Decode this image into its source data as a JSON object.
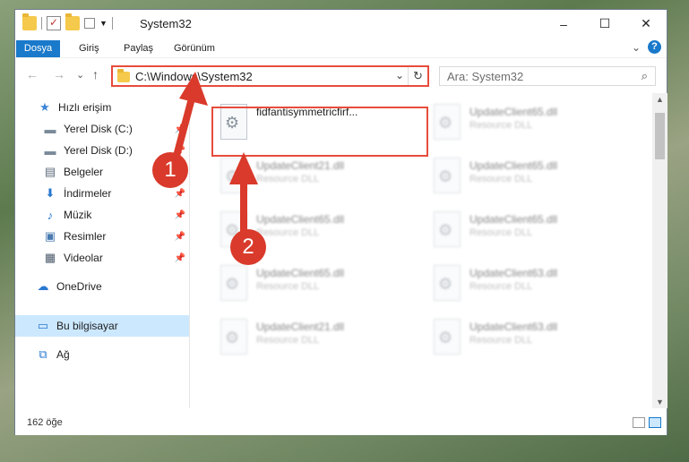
{
  "window": {
    "title": "System32",
    "controls": [
      "–",
      "☐",
      "✕"
    ]
  },
  "ribbon": {
    "tabs": [
      "Dosya",
      "Giriş",
      "Paylaş",
      "Görünüm"
    ],
    "chevron": "⌄",
    "help": "?"
  },
  "navbar": {
    "back": "←",
    "forward": "→",
    "recent": "⌄",
    "up": "↑",
    "address": "C:\\Windows\\System32",
    "address_dropdown": "⌄",
    "refresh": "↻",
    "search_placeholder": "Ara: System32",
    "search_icon": "⌕"
  },
  "sidebar": {
    "items": [
      {
        "label": "Hızlı erişim",
        "icon": "star-icon",
        "glyph": "★",
        "color": "#3b84d6",
        "pinned": false
      },
      {
        "label": "Yerel Disk (C:)",
        "icon": "drive-icon",
        "glyph": "▬",
        "color": "#7a8a99",
        "pinned": true
      },
      {
        "label": "Yerel Disk (D:)",
        "icon": "drive-icon",
        "glyph": "▬",
        "color": "#7a8a99",
        "pinned": true
      },
      {
        "label": "Belgeler",
        "icon": "documents-icon",
        "glyph": "▤",
        "color": "#5b6b7a",
        "pinned": true
      },
      {
        "label": "İndirmeler",
        "icon": "download-icon",
        "glyph": "⬇",
        "color": "#2a78d0",
        "pinned": true
      },
      {
        "label": "Müzik",
        "icon": "music-icon",
        "glyph": "♪",
        "color": "#2a78d0",
        "pinned": true
      },
      {
        "label": "Resimler",
        "icon": "pictures-icon",
        "glyph": "▣",
        "color": "#4a7ab0",
        "pinned": true
      },
      {
        "label": "Videolar",
        "icon": "videos-icon",
        "glyph": "▦",
        "color": "#4a5a6a",
        "pinned": true
      },
      {
        "label": "OneDrive",
        "icon": "onedrive-icon",
        "glyph": "☁",
        "color": "#2a78d0",
        "pinned": false
      },
      {
        "label": "Bu bilgisayar",
        "icon": "computer-icon",
        "glyph": "▭",
        "color": "#2a78d0",
        "pinned": false
      },
      {
        "label": "Ağ",
        "icon": "network-icon",
        "glyph": "⧉",
        "color": "#2a78d0",
        "pinned": false
      }
    ],
    "pin_glyph": "📌"
  },
  "files": [
    {
      "name": "fidfantisymmetricfirf...",
      "type": ""
    },
    {
      "name": "UpdateClient65.dll",
      "type": "Resource DLL"
    },
    {
      "name": "UpdateClient21.dll",
      "type": "Resource DLL"
    },
    {
      "name": "UpdateClient65.dll",
      "type": "Resource DLL"
    },
    {
      "name": "UpdateClient65.dll",
      "type": "Resource DLL"
    },
    {
      "name": "UpdateClient65.dll",
      "type": "Resource DLL"
    },
    {
      "name": "UpdateClient65.dll",
      "type": "Resource DLL"
    },
    {
      "name": "UpdateClient63.dll",
      "type": "Resource DLL"
    },
    {
      "name": "UpdateClient21.dll",
      "type": "Resource DLL"
    },
    {
      "name": "UpdateClient63.dll",
      "type": "Resource DLL"
    }
  ],
  "status": {
    "count": "162 öğe"
  },
  "annotations": {
    "step1": "1",
    "step2": "2",
    "color": "#d93a2b"
  }
}
